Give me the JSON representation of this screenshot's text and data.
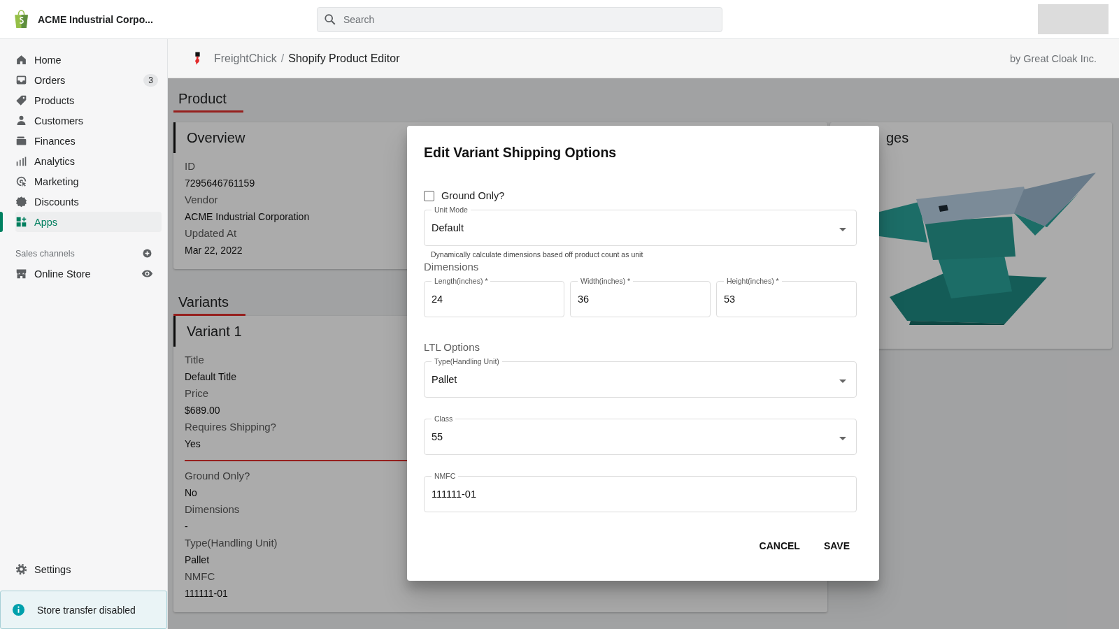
{
  "top_bar": {
    "store_name": "ACME Industrial Corpo...",
    "search": {
      "placeholder": "Search"
    }
  },
  "sidebar": {
    "items": [
      {
        "label": "Home",
        "selected": false
      },
      {
        "label": "Orders",
        "selected": false,
        "badge": "3"
      },
      {
        "label": "Products",
        "selected": false
      },
      {
        "label": "Customers",
        "selected": false
      },
      {
        "label": "Finances",
        "selected": false
      },
      {
        "label": "Analytics",
        "selected": false
      },
      {
        "label": "Marketing",
        "selected": false
      },
      {
        "label": "Discounts",
        "selected": false
      },
      {
        "label": "Apps",
        "selected": true
      }
    ],
    "sales_channels": {
      "title": "Sales channels",
      "items": [
        {
          "label": "Online Store"
        }
      ]
    },
    "settings": "Settings",
    "notice": "Store transfer disabled"
  },
  "app_header": {
    "app_name": "FreightChick",
    "separator": "/",
    "page_title": "Shopify Product Editor",
    "byline": "by Great Cloak Inc."
  },
  "product_heading": "Product",
  "overview": {
    "title": "Overview",
    "fields": [
      {
        "label": "ID",
        "value": "7295646761159"
      },
      {
        "label": "Vendor",
        "value": "ACME Industrial Corporation"
      },
      {
        "label": "Updated At",
        "value": "Mar 22, 2022"
      }
    ]
  },
  "variants_heading": "Variants",
  "variant": {
    "title": "Variant 1",
    "fields": [
      {
        "label": "Title",
        "value": "Default Title"
      },
      {
        "label": "Price",
        "value": "$689.00"
      },
      {
        "label": "Requires Shipping?",
        "value": "Yes"
      }
    ],
    "shipping_fields": [
      {
        "label": "Ground Only?",
        "value": "No"
      },
      {
        "label": "Dimensions",
        "value": "-"
      },
      {
        "label": "Type(Handling Unit)",
        "value": "Pallet"
      },
      {
        "label": "NMFC",
        "value": "111111-01"
      }
    ]
  },
  "images": {
    "title": "ges"
  },
  "dialog": {
    "title": "Edit Variant Shipping Options",
    "ground_only": {
      "label": "Ground Only?",
      "checked": false
    },
    "unit_mode": {
      "label": "Unit Mode",
      "value": "Default",
      "helper": "Dynamically calculate dimensions based off product count as unit"
    },
    "dimensions": {
      "title": "Dimensions",
      "fields": [
        {
          "label": "Length(inches) *",
          "value": "24"
        },
        {
          "label": "Width(inches) *",
          "value": "36"
        },
        {
          "label": "Height(inches) *",
          "value": "53"
        }
      ]
    },
    "ltl_options": {
      "title": "LTL Options",
      "fields": [
        {
          "kind": "select",
          "label": "Type(Handling Unit)",
          "value": "Pallet"
        },
        {
          "kind": "select",
          "label": "Class",
          "value": "55"
        },
        {
          "kind": "text",
          "label": "NMFC",
          "value": "111111-01"
        }
      ]
    },
    "buttons": [
      "CANCEL",
      "SAVE"
    ]
  }
}
